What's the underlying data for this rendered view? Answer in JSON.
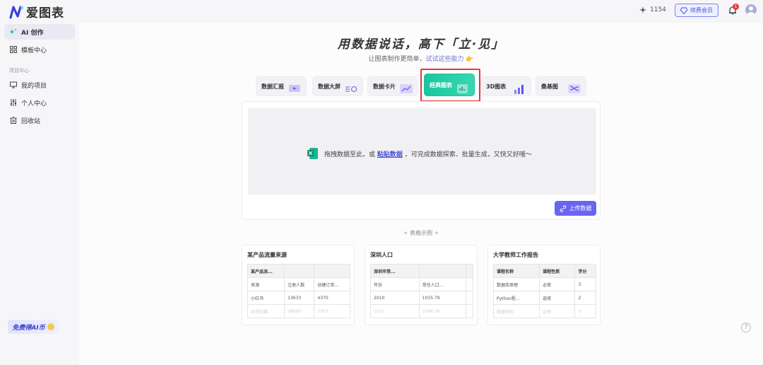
{
  "header": {
    "logo_text": "爱图表",
    "credits": "1154",
    "renew_label": "续费会员",
    "notification_count": "1"
  },
  "sidebar": {
    "items": [
      {
        "label": "AI 创作",
        "icon": "sparkle-icon"
      },
      {
        "label": "模板中心",
        "icon": "grid-icon"
      }
    ],
    "group_title": "项目中心",
    "project_items": [
      {
        "label": "我的项目",
        "icon": "monitor-icon"
      },
      {
        "label": "个人中心",
        "icon": "sliders-icon"
      },
      {
        "label": "回收站",
        "icon": "trash-icon"
      }
    ],
    "free_ai_label": "免费得AI币"
  },
  "hero": {
    "title": "用数据说话，高下「立·见」",
    "subtitle_prefix": "让图表制作更简单，",
    "subtitle_highlight": "试试这些能力",
    "emoji": "👉"
  },
  "tabs": [
    {
      "label": "数据汇报"
    },
    {
      "label": "数据大屏"
    },
    {
      "label": "数据卡片"
    },
    {
      "label": "经典图表"
    },
    {
      "label": "3D图表"
    },
    {
      "label": "桑基图"
    }
  ],
  "upload": {
    "drop_text_prefix": "拖拽数据至此，或",
    "drop_link": "粘贴数据",
    "drop_text_suffix": "，可完成数据探索、批量生成，又快又好哦～",
    "upload_button": "上传数据"
  },
  "samples": {
    "label": "表格示例",
    "cards": [
      {
        "title": "某产品流量来源",
        "rows": [
          [
            "某产品流...",
            "",
            ""
          ],
          [
            "来源",
            "注册人数",
            "创建订单..."
          ],
          [
            "小红书",
            "13633",
            "4370"
          ],
          [
            "自然流量",
            "28695",
            "7953"
          ]
        ]
      },
      {
        "title": "深圳人口",
        "rows": [
          [
            "深圳市常...",
            "",
            ""
          ],
          [
            "年份",
            "常住人口...",
            ""
          ],
          [
            "2010",
            "1035.79",
            ""
          ],
          [
            "2011",
            "1046.74",
            ""
          ]
        ]
      },
      {
        "title": "大学教师工作报告",
        "rows": [
          [
            "课程名称",
            "课程性质",
            "学分"
          ],
          [
            "数据库原理",
            "必修",
            "3"
          ],
          [
            "Python程...",
            "选修",
            "2"
          ],
          [
            "数据结构",
            "必修",
            "3"
          ]
        ]
      }
    ]
  },
  "help_label": "?",
  "colors": {
    "accent": "#6b64f0",
    "active_tab": "#19c6a0",
    "highlight": "#e0393e"
  }
}
